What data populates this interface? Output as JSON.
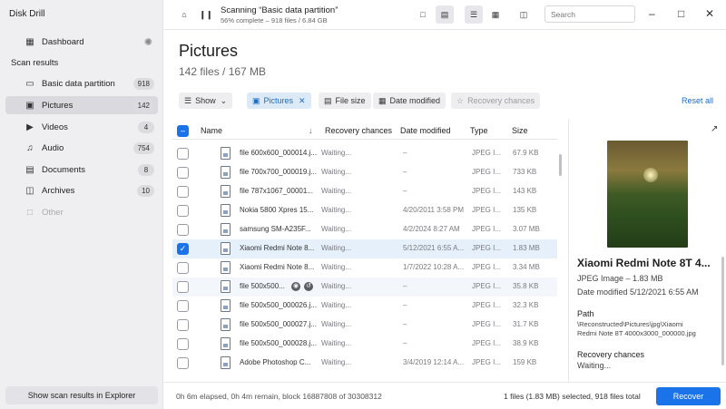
{
  "app": {
    "title": "Disk Drill"
  },
  "sidebar": {
    "dashboard": {
      "label": "Dashboard"
    },
    "section_label": "Scan results",
    "items": [
      {
        "label": "Basic data partition",
        "count": "918",
        "icon": "drive-icon"
      },
      {
        "label": "Pictures",
        "count": "142",
        "icon": "picture-icon"
      },
      {
        "label": "Videos",
        "count": "4",
        "icon": "video-icon"
      },
      {
        "label": "Audio",
        "count": "754",
        "icon": "music-icon"
      },
      {
        "label": "Documents",
        "count": "8",
        "icon": "document-icon"
      },
      {
        "label": "Archives",
        "count": "10",
        "icon": "archive-icon"
      },
      {
        "label": "Other",
        "count": "",
        "icon": "other-icon"
      }
    ],
    "explorer_button": "Show scan results in Explorer"
  },
  "topbar": {
    "scan_title": "Scanning “Basic data partition”",
    "scan_sub": "56% complete – 918 files / 6.84 GB",
    "search_placeholder": "Search"
  },
  "main": {
    "title": "Pictures",
    "subtitle": "142 files / 167 MB",
    "filters": {
      "show": "Show",
      "pictures": "Pictures",
      "file_size": "File size",
      "date_modified": "Date modified",
      "recovery_chances": "Recovery chances"
    },
    "reset_all": "Reset all"
  },
  "table": {
    "headers": {
      "name": "Name",
      "recovery": "Recovery chances",
      "date": "Date modified",
      "type": "Type",
      "size": "Size"
    },
    "rows": [
      {
        "name": "file 600x600_000014.j...",
        "recovery": "Waiting...",
        "date": "–",
        "type": "JPEG I...",
        "size": "67.9 KB"
      },
      {
        "name": "file 700x700_000019.j...",
        "recovery": "Waiting...",
        "date": "–",
        "type": "JPEG I...",
        "size": "733 KB"
      },
      {
        "name": "file 787x1067_00001...",
        "recovery": "Waiting...",
        "date": "–",
        "type": "JPEG I...",
        "size": "143 KB"
      },
      {
        "name": "Nokia 5800 Xpres 15...",
        "recovery": "Waiting...",
        "date": "4/20/2011 3:58 PM",
        "type": "JPEG I...",
        "size": "135 KB"
      },
      {
        "name": "samsung SM-A235F...",
        "recovery": "Waiting...",
        "date": "4/2/2024 8:27 AM",
        "type": "JPEG I...",
        "size": "3.07 MB"
      },
      {
        "name": "Xiaomi Redmi Note 8...",
        "recovery": "Waiting...",
        "date": "5/12/2021 6:55 A...",
        "type": "JPEG I...",
        "size": "1.83 MB"
      },
      {
        "name": "Xiaomi Redmi Note 8...",
        "recovery": "Waiting...",
        "date": "1/7/2022 10:28 A...",
        "type": "JPEG I...",
        "size": "3.34 MB"
      },
      {
        "name": "file 500x500...",
        "recovery": "Waiting...",
        "date": "–",
        "type": "JPEG I...",
        "size": "35.8 KB"
      },
      {
        "name": "file 500x500_000026.j...",
        "recovery": "Waiting...",
        "date": "–",
        "type": "JPEG I...",
        "size": "32.3 KB"
      },
      {
        "name": "file 500x500_000027.j...",
        "recovery": "Waiting...",
        "date": "–",
        "type": "JPEG I...",
        "size": "31.7 KB"
      },
      {
        "name": "file 500x500_000028.j...",
        "recovery": "Waiting...",
        "date": "–",
        "type": "JPEG I...",
        "size": "38.9 KB"
      },
      {
        "name": "Adobe Photoshop C...",
        "recovery": "Waiting...",
        "date": "3/4/2019 12:14 A...",
        "type": "JPEG I...",
        "size": "159 KB"
      }
    ]
  },
  "preview": {
    "title": "Xiaomi Redmi Note 8T 4...",
    "type_size": "JPEG Image – 1.83 MB",
    "date": "Date modified 5/12/2021 6:55 AM",
    "path_label": "Path",
    "path_line1": "\\Reconstructed\\Pictures\\jpg\\Xiaomi",
    "path_line2": "Redmi Note 8T 4000x3000_000000.jpg",
    "recovery_label": "Recovery chances",
    "recovery_value": "Waiting..."
  },
  "footer": {
    "status": "0h 6m elapsed, 0h 4m remain, block 16887808 of 30308312",
    "selection": "1 files (1.83 MB) selected, 918 files total",
    "recover": "Recover"
  }
}
